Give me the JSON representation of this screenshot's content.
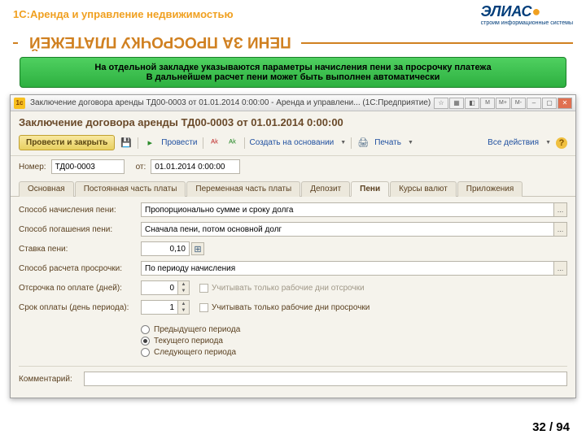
{
  "slide": {
    "product": "1С:Аренда и управление недвижимостью",
    "logo": "ЭЛИАС",
    "logo_sub": "строим информационные системы",
    "title": "ПЕНИ ЗА ПРОСРОЧКУ ПЛАТЕЖЕЙ",
    "callout_line1": "На отдельной закладке указываются параметры начисления пени за просрочку платежа",
    "callout_line2": "В дальнейшем расчет пени может быть выполнен автоматически",
    "page": "32 / 94"
  },
  "window": {
    "titlebar_icon": "1с",
    "title": "Заключение договора аренды ТД00-0003 от 01.01.2014 0:00:00 - Аренда и управлени...  (1С:Предприятие)",
    "doc_title": "Заключение договора аренды ТД00-0003 от 01.01.2014 0:00:00",
    "toolbar": {
      "post_close": "Провести и закрыть",
      "post": "Провести",
      "create_based": "Создать на основании",
      "print": "Печать",
      "all_actions": "Все действия"
    },
    "header": {
      "number_label": "Номер:",
      "number_value": "ТД00-0003",
      "date_label": "от:",
      "date_value": "01.01.2014 0:00:00"
    },
    "tabs": [
      "Основная",
      "Постоянная часть платы",
      "Переменная часть платы",
      "Депозит",
      "Пени",
      "Курсы валют",
      "Приложения"
    ],
    "active_tab": 4,
    "fields": {
      "method_label": "Способ начисления пени:",
      "method_value": "Пропорционально сумме и сроку долга",
      "repay_label": "Способ погашения пени:",
      "repay_value": "Сначала пени, потом основной долг",
      "rate_label": "Ставка пени:",
      "rate_value": "0,10",
      "calc_label": "Способ расчета просрочки:",
      "calc_value": "По периоду начисления",
      "delay_label": "Отсрочка по оплате (дней):",
      "delay_value": "0",
      "delay_check": "Учитывать только рабочие дни отсрочки",
      "term_label": "Срок оплаты (день периода):",
      "term_value": "1",
      "term_check": "Учитывать только рабочие дни просрочки",
      "radio1": "Предыдущего периода",
      "radio2": "Текущего периода",
      "radio3": "Следующего периода",
      "comment_label": "Комментарий:"
    }
  }
}
